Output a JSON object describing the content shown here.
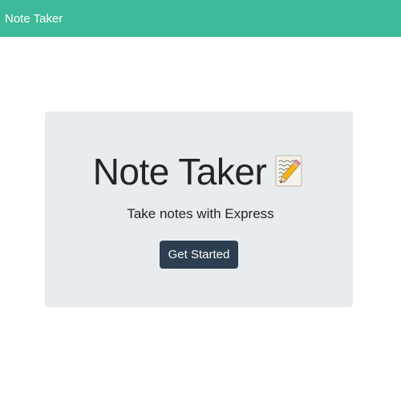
{
  "navbar": {
    "brand": "Note Taker",
    "color": "#3dba98"
  },
  "hero": {
    "title": "Note Taker",
    "title_icon": "memo-pencil-icon",
    "subtitle": "Take notes with Express",
    "button_label": "Get Started",
    "button_color": "#2c3e50",
    "background": "#e9ecef"
  }
}
